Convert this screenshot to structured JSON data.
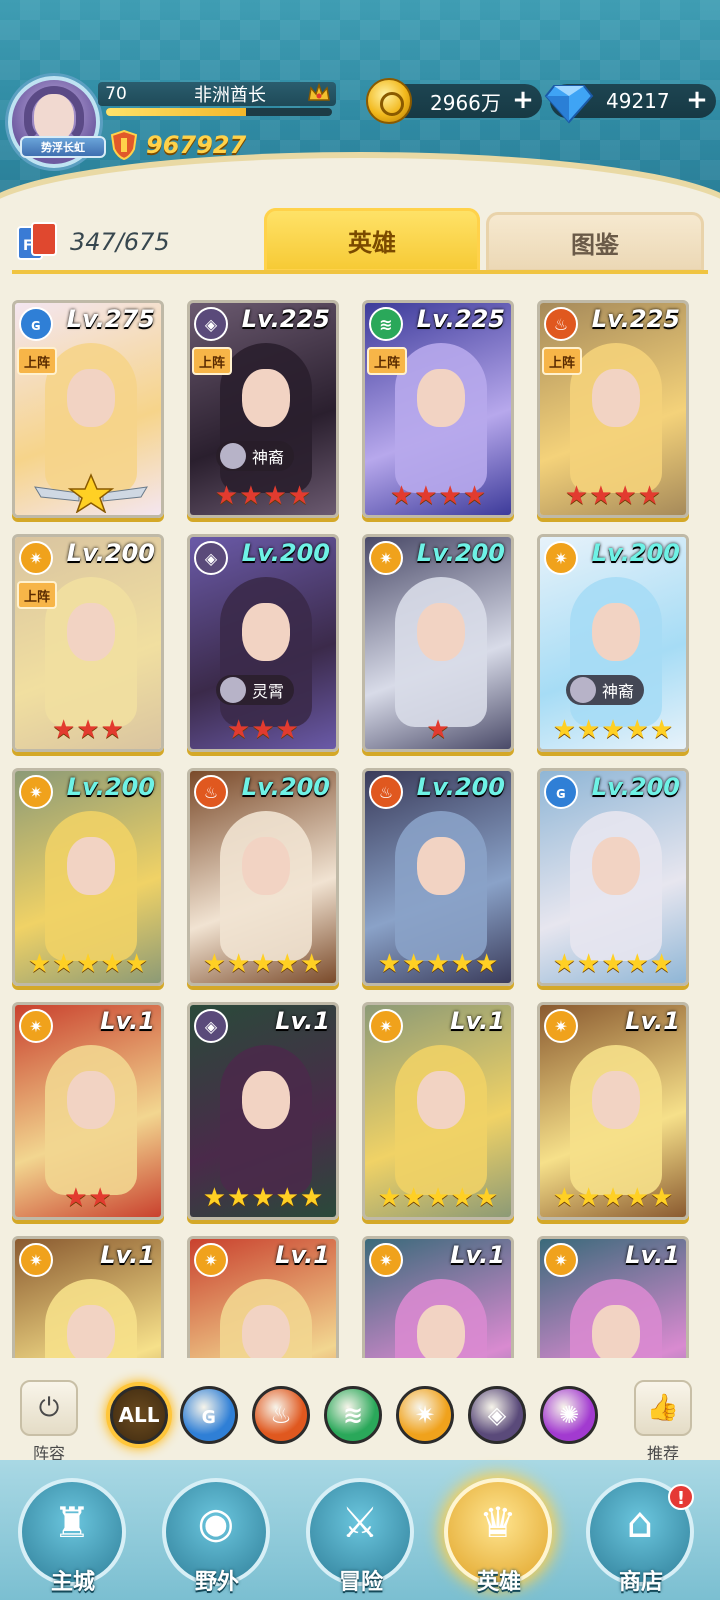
{
  "player": {
    "avatar_title": "势浮长虹",
    "level": "70",
    "name": "非洲酋长",
    "power": "967927",
    "xp_fraction": 0.62
  },
  "resources": {
    "gold": "2966万",
    "gems": "49217"
  },
  "collection": {
    "count": "347/675"
  },
  "tabs": {
    "heroes": "英雄",
    "album": "图鉴"
  },
  "hero_cards": [
    {
      "level": "Lv.275",
      "element": "water",
      "deployed": "上阵",
      "tag": "",
      "stars": 1,
      "star_color": "gold",
      "rank_badge": true,
      "art": [
        "#f6d48a",
        "#f4e6f0"
      ]
    },
    {
      "level": "Lv.225",
      "element": "dark",
      "deployed": "上阵",
      "tag": "神裔",
      "stars": 4,
      "star_color": "red",
      "rank_badge": false,
      "art": [
        "#2a1f2e",
        "#6b5a70"
      ]
    },
    {
      "level": "Lv.225",
      "element": "wind",
      "deployed": "上阵",
      "tag": "",
      "stars": 4,
      "star_color": "red",
      "rank_badge": false,
      "art": [
        "#b7a8ec",
        "#3d3b9a"
      ]
    },
    {
      "level": "Lv.225",
      "element": "fire",
      "deployed": "上阵",
      "tag": "",
      "stars": 4,
      "star_color": "red",
      "rank_badge": false,
      "art": [
        "#f4d27a",
        "#a68a5a"
      ]
    },
    {
      "level": "Lv.200",
      "element": "light",
      "deployed": "上阵",
      "tag": "",
      "stars": 3,
      "star_color": "red",
      "rank_badge": false,
      "art": [
        "#f1dfa0",
        "#d9c4a0"
      ],
      "cyan": false
    },
    {
      "level": "Lv.200",
      "element": "dark",
      "deployed": "",
      "tag": "灵霄",
      "stars": 3,
      "star_color": "red",
      "rank_badge": false,
      "art": [
        "#3b2a4a",
        "#6a5aa8"
      ],
      "cyan": true
    },
    {
      "level": "Lv.200",
      "element": "light",
      "deployed": "",
      "tag": "",
      "stars": 1,
      "star_color": "red",
      "rank_badge": false,
      "art": [
        "#d8dbe8",
        "#4a4a68"
      ],
      "cyan": true
    },
    {
      "level": "Lv.200",
      "element": "light",
      "deployed": "",
      "tag": "神裔",
      "stars": 5,
      "star_color": "gold",
      "rank_badge": false,
      "art": [
        "#a6dcf5",
        "#e7f2fa"
      ],
      "cyan": true
    },
    {
      "level": "Lv.200",
      "element": "light",
      "deployed": "",
      "tag": "",
      "stars": 5,
      "star_color": "gold",
      "rank_badge": false,
      "art": [
        "#f0d266",
        "#8c9a76"
      ],
      "cyan": true
    },
    {
      "level": "Lv.200",
      "element": "fire",
      "deployed": "",
      "tag": "",
      "stars": 5,
      "star_color": "gold",
      "rank_badge": false,
      "art": [
        "#f1e3d2",
        "#7a4a2a"
      ],
      "cyan": true
    },
    {
      "level": "Lv.200",
      "element": "fire",
      "deployed": "",
      "tag": "",
      "stars": 5,
      "star_color": "gold",
      "rank_badge": false,
      "art": [
        "#8aa2c8",
        "#3a3b5a"
      ],
      "cyan": true
    },
    {
      "level": "Lv.200",
      "element": "water",
      "deployed": "",
      "tag": "",
      "stars": 5,
      "star_color": "gold",
      "rank_badge": false,
      "art": [
        "#e7e6ef",
        "#8fb6d6"
      ],
      "cyan": true
    },
    {
      "level": "Lv.1",
      "element": "light",
      "deployed": "",
      "tag": "",
      "stars": 2,
      "star_color": "red",
      "rank_badge": false,
      "art": [
        "#f2d690",
        "#c9412e"
      ]
    },
    {
      "level": "Lv.1",
      "element": "dark",
      "deployed": "",
      "tag": "",
      "stars": 5,
      "star_color": "gold",
      "rank_badge": false,
      "art": [
        "#4a2a4a",
        "#2a4a3a"
      ]
    },
    {
      "level": "Lv.1",
      "element": "light",
      "deployed": "",
      "tag": "",
      "stars": 5,
      "star_color": "gold",
      "rank_badge": false,
      "art": [
        "#f0d266",
        "#8c9a76"
      ]
    },
    {
      "level": "Lv.1",
      "element": "light",
      "deployed": "",
      "tag": "",
      "stars": 5,
      "star_color": "gold",
      "rank_badge": false,
      "art": [
        "#f6e08a",
        "#8a5a30"
      ]
    },
    {
      "level": "Lv.1",
      "element": "light",
      "deployed": "",
      "tag": "",
      "stars": 0,
      "star_color": "gold",
      "rank_badge": false,
      "art": [
        "#f6e08a",
        "#8a5a30"
      ]
    },
    {
      "level": "Lv.1",
      "element": "light",
      "deployed": "",
      "tag": "",
      "stars": 0,
      "star_color": "gold",
      "rank_badge": false,
      "art": [
        "#f2d690",
        "#c9412e"
      ]
    },
    {
      "level": "Lv.1",
      "element": "light",
      "deployed": "",
      "tag": "",
      "stars": 0,
      "star_color": "gold",
      "rank_badge": false,
      "art": [
        "#d98ad0",
        "#3a6a7a"
      ]
    },
    {
      "level": "Lv.1",
      "element": "light",
      "deployed": "",
      "tag": "",
      "stars": 0,
      "star_color": "gold",
      "rank_badge": false,
      "art": [
        "#d98ad0",
        "#3a6a7a"
      ]
    }
  ],
  "element_colors": {
    "water": "#2f7fd6",
    "dark": "#5a4a7a",
    "wind": "#2aa85a",
    "fire": "#e0581f",
    "light": "#f0a21c",
    "void": "#a23ad0"
  },
  "filter": {
    "lineup_label": "阵容",
    "recommend_label": "推荐",
    "all_label": "ALL",
    "elements": [
      "water",
      "fire",
      "wind",
      "light",
      "dark",
      "void"
    ]
  },
  "nav": {
    "items": [
      {
        "label": "主城",
        "icon": "castle-icon"
      },
      {
        "label": "野外",
        "icon": "portal-icon"
      },
      {
        "label": "冒险",
        "icon": "sword-icon"
      },
      {
        "label": "英雄",
        "icon": "helmet-icon"
      },
      {
        "label": "商店",
        "icon": "shop-icon"
      }
    ],
    "active": 3,
    "shop_notify": "!"
  }
}
